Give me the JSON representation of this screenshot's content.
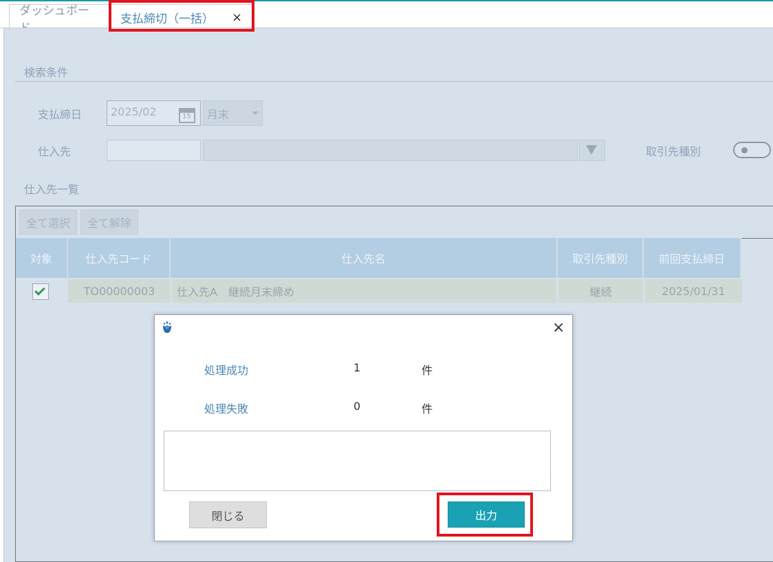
{
  "tabs": [
    {
      "label": "ダッシュボード"
    },
    {
      "label": "支払締切（一括）",
      "close": "×"
    }
  ],
  "search": {
    "section_title": "検索条件",
    "pay_close_date_label": "支払締日",
    "pay_close_date_value": "2025/02",
    "calendar_day": "15",
    "period_value": "月末",
    "supplier_label": "仕入先",
    "partner_type_label": "取引先種別"
  },
  "list": {
    "section_title": "仕入先一覧",
    "select_all": "全て選択",
    "deselect_all": "全て解除",
    "columns": [
      "対象",
      "仕入先コード",
      "仕入先名",
      "取引先種別",
      "前回支払締日"
    ],
    "rows": [
      {
        "checked": true,
        "code": "TO00000003",
        "name": "仕入先A　継続月末締め",
        "type": "継続",
        "last_date": "2025/01/31"
      }
    ]
  },
  "dialog": {
    "success_label": "処理成功",
    "success_count": "1",
    "success_unit": "件",
    "fail_label": "処理失敗",
    "fail_count": "0",
    "fail_unit": "件",
    "close_label": "閉じる",
    "output_label": "出力",
    "close_icon": "×"
  },
  "colors": {
    "accent": "#1aa2b4",
    "highlight": "#e0151f",
    "label": "#4a88b8"
  }
}
